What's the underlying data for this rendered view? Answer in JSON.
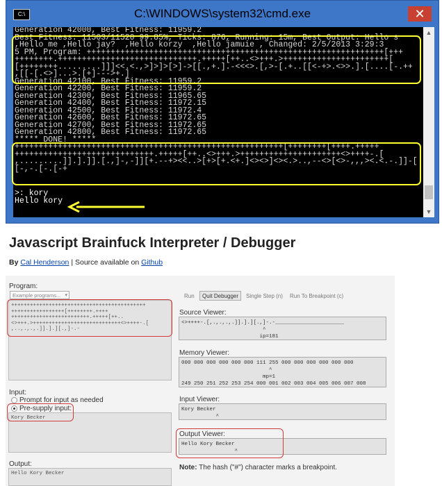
{
  "cmd": {
    "title": "C:\\WINDOWS\\system32\\cmd.exe",
    "app_icon_text": "C:\\",
    "close_symbol": "✕",
    "lines": [
      "Generation 42000, Best Fitness: 11959.2",
      "Best Fitness: 11503/11520 99.85%, Ticks: 876, Running: 15m, Best Output: Hello s",
      ",Hello me ,Hello jay?  ,Hello korzy  ,Hello jamuie , Changed: 2/5/2013 3:29:3",
      "5 PM, Program: ++++++++++++++++++++++++++++++++++++++++++++++++++++++++++++++[+++",
      "++++++++.+++++++++++++++++++++++++++++.+++++[++..<>+++.>++++++++++++++++++++++[",
      "[++++++++.........]]]<<.<.,>]>]>[>]->[[.,+.].-<<<>.[,>-[.+..[[<-+>.<>>.].[....[-.++",
      ",[[-[.<>]...>.[+]--->+.]",
      "Generation 42100, Best Fitness: 11959.2",
      "Generation 42200, Best Fitness: 11959.2",
      "Generation 42300, Best Fitness: 11965.65",
      "Generation 42400, Best Fitness: 11972.15",
      "Generation 42500, Best Fitness: 11972.4",
      "Generation 42600, Best Fitness: 11972.65",
      "Generation 42700, Best Fitness: 11972.65",
      "Generation 42800, Best Fitness: 11972.65",
      "***** DONE! *****",
      "++++++++++++++++++++++++++++++++++++++++++++++++++++++++[++++++++[++++.+++++",
      "+++++++++++++++++++++++++++++.+++++[++..<>+++.>+++++++++++++++++++++<>++++-.[",
      ",.........]].].]].[.,]-,-]][+.--+><<..>[+>[+.<+.]<><>]<><.>..,--<>[<>-,,,><.<.-.]]-[",
      "[-,-.[-.[-+",
      "",
      "",
      ">: kory",
      "Hello kory"
    ]
  },
  "page": {
    "title": "Javascript Brainfuck Interpreter / Debugger",
    "by": "By",
    "author": "Cal Henderson",
    "source_text": "| Source available on",
    "source_link": "Github",
    "program_label": "Program:",
    "example_select": "Example programs...",
    "program_code": "+++++++++++++++++++++++++++++++++++++++++++\n+++++++++++++++++[++++++++.++++\n+++++++++++++++++++++++++.+++++[++..\n<>+++.>++++++++++++++++++++++++++++<>++++-.[\n,..,.,.,.]].].][.,]-.-",
    "input_label": "Input:",
    "radio_prompt": "Prompt for input as needed",
    "radio_presupply": "Pre-supply input:",
    "input_value": "Kory Becker",
    "output_label": "Output:",
    "output_value": "Hello Kory Becker",
    "buttons": {
      "run": "Run",
      "quit": "Quit Debugger",
      "step": "Single Step (n)",
      "breakpoint": "Run To Breakpoint (c)"
    },
    "source_viewer_label": "Source Viewer:",
    "source_viewer_text": "<>++++-.[,.,.,.,.]].].][.,]-.-______________________\n                          ^\n                         ip=181",
    "memory_viewer_label": "Memory Viewer:",
    "memory_viewer_text": "000 000 000 000 000 000 111 255 000 000 000 000 000 000\n                            ^\n                          mp=1\n249 250 251 252 253 254 000 001 002 003 004 005 006 007 008",
    "input_viewer_label": "Input Viewer:",
    "input_viewer_text": "Kory Becker\n           ^",
    "output_viewer_label": "Output Viewer:",
    "output_viewer_text": "Hello Kory Becker\n                 ^",
    "note_bold": "Note:",
    "note_text": "The hash (\"#\") character marks a breakpoint."
  },
  "colors": {
    "highlight_yellow": "#ffff33",
    "highlight_red": "#d13b3b",
    "title_bar": "#3e76c8"
  }
}
